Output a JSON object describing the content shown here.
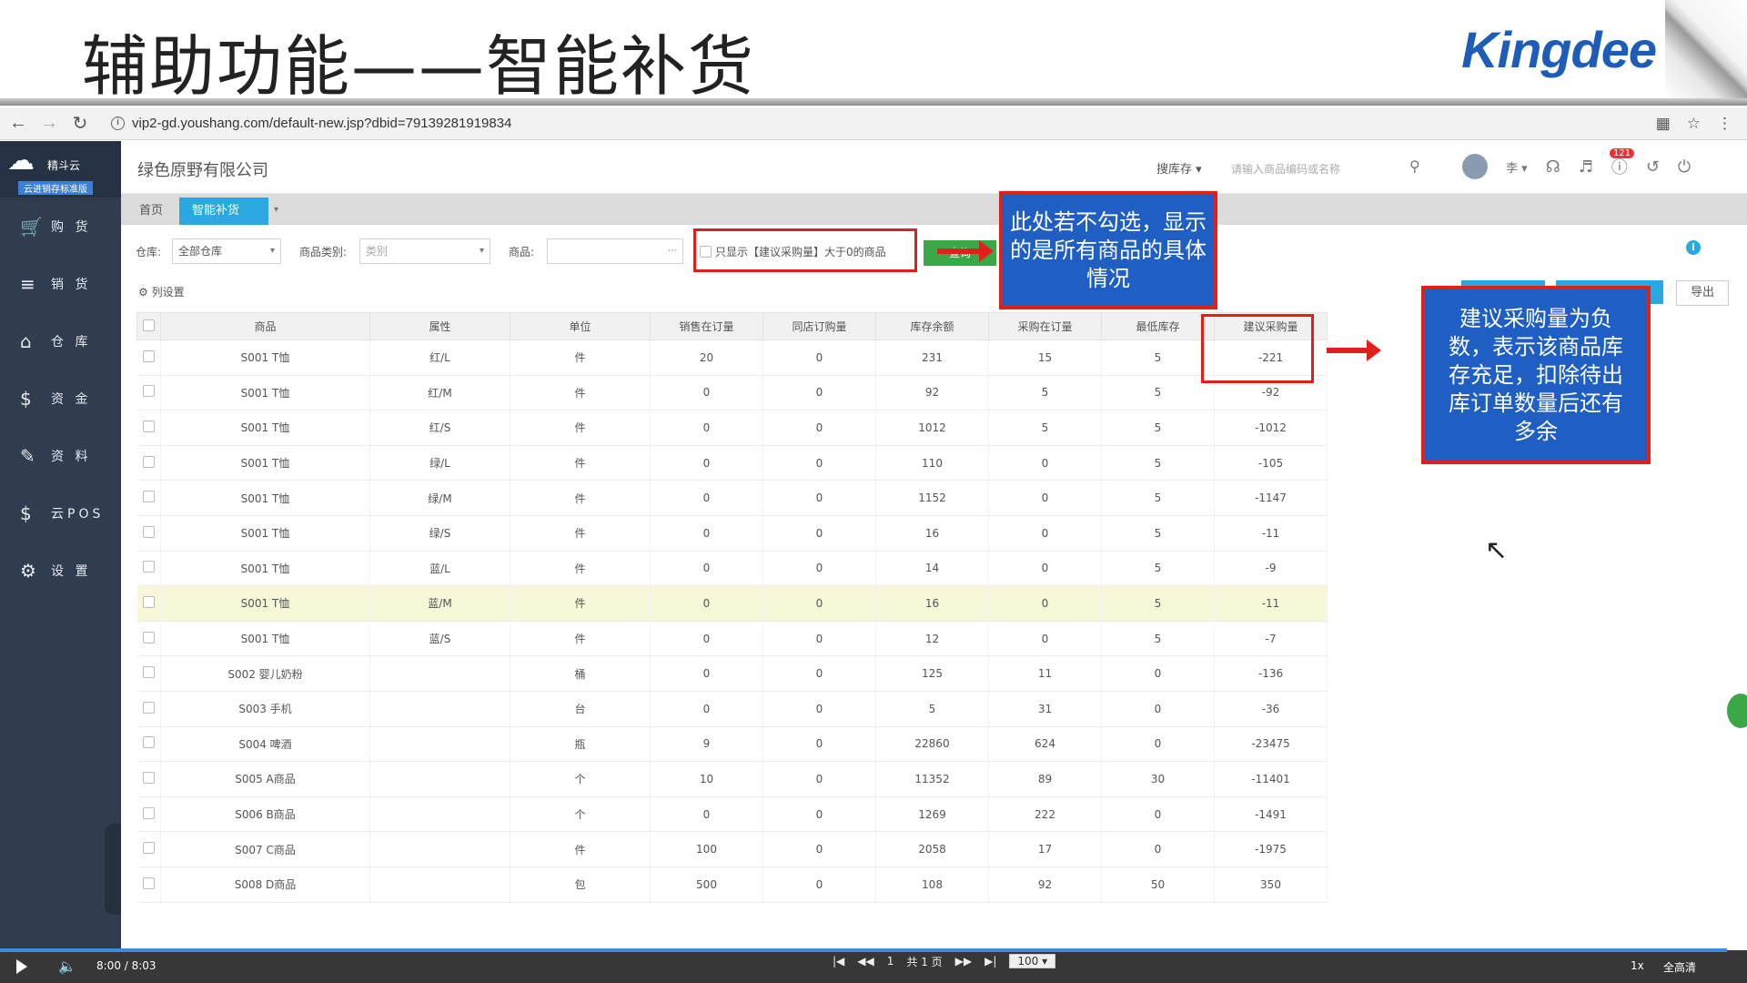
{
  "slide": {
    "title": "辅助功能——智能补货",
    "logo": "Kingdee"
  },
  "browser": {
    "url": "vip2-gd.youshang.com/default-new.jsp?dbid=79139281919834"
  },
  "sidebar": {
    "brand_name": "精斗云",
    "brand_sub": "云进销存标准版",
    "items": [
      {
        "label": "购 货",
        "icon": "cart-icon"
      },
      {
        "label": "销 货",
        "icon": "sales-icon"
      },
      {
        "label": "仓 库",
        "icon": "warehouse-icon"
      },
      {
        "label": "资 金",
        "icon": "money-icon"
      },
      {
        "label": "资 料",
        "icon": "pencil-icon"
      },
      {
        "label": "云POS",
        "icon": "pos-icon"
      },
      {
        "label": "设 置",
        "icon": "gear-icon"
      }
    ]
  },
  "header": {
    "company": "绿色原野有限公司",
    "search_type": "搜库存",
    "search_placeholder": "请输入商品编码或名称",
    "user": "李",
    "badge": "121"
  },
  "tabs": {
    "home": "首页",
    "active": "智能补货"
  },
  "filters": {
    "warehouse_label": "仓库:",
    "warehouse_value": "全部仓库",
    "category_label": "商品类别:",
    "category_placeholder": "类别",
    "product_label": "商品:",
    "only_show_label": "只显示【建议采购量】大于0的商品",
    "query_button": "查询"
  },
  "toolbar": {
    "column_settings": "列设置",
    "export": "导出"
  },
  "table": {
    "headers": [
      "商品",
      "属性",
      "单位",
      "销售在订量",
      "同店订购量",
      "库存余额",
      "采购在订量",
      "最低库存",
      "建议采购量"
    ],
    "rows": [
      [
        "S001 T恤",
        "红/L",
        "件",
        "20",
        "0",
        "231",
        "15",
        "5",
        "-221"
      ],
      [
        "S001 T恤",
        "红/M",
        "件",
        "0",
        "0",
        "92",
        "5",
        "5",
        "-92"
      ],
      [
        "S001 T恤",
        "红/S",
        "件",
        "0",
        "0",
        "1012",
        "5",
        "5",
        "-1012"
      ],
      [
        "S001 T恤",
        "绿/L",
        "件",
        "0",
        "0",
        "110",
        "0",
        "5",
        "-105"
      ],
      [
        "S001 T恤",
        "绿/M",
        "件",
        "0",
        "0",
        "1152",
        "0",
        "5",
        "-1147"
      ],
      [
        "S001 T恤",
        "绿/S",
        "件",
        "0",
        "0",
        "16",
        "0",
        "5",
        "-11"
      ],
      [
        "S001 T恤",
        "蓝/L",
        "件",
        "0",
        "0",
        "14",
        "0",
        "5",
        "-9"
      ],
      [
        "S001 T恤",
        "蓝/M",
        "件",
        "0",
        "0",
        "16",
        "0",
        "5",
        "-11"
      ],
      [
        "S001 T恤",
        "蓝/S",
        "件",
        "0",
        "0",
        "12",
        "0",
        "5",
        "-7"
      ],
      [
        "S002 婴儿奶粉",
        "",
        "桶",
        "0",
        "0",
        "125",
        "11",
        "0",
        "-136"
      ],
      [
        "S003 手机",
        "",
        "台",
        "0",
        "0",
        "5",
        "31",
        "0",
        "-36"
      ],
      [
        "S004 啤酒",
        "",
        "瓶",
        "9",
        "0",
        "22860",
        "624",
        "0",
        "-23475"
      ],
      [
        "S005 A商品",
        "",
        "个",
        "10",
        "0",
        "11352",
        "89",
        "30",
        "-11401"
      ],
      [
        "S006 B商品",
        "",
        "个",
        "0",
        "0",
        "1269",
        "222",
        "0",
        "-1491"
      ],
      [
        "S007 C商品",
        "",
        "件",
        "100",
        "0",
        "2058",
        "17",
        "0",
        "-1975"
      ],
      [
        "S008 D商品",
        "",
        "包",
        "500",
        "0",
        "108",
        "92",
        "50",
        "350"
      ]
    ]
  },
  "annotations": {
    "callout1": "此处若不勾选，显示的是所有商品的具体情况",
    "callout2": "建议采购量为负数，表示该商品库存充足，扣除待出库订单数量后还有多余"
  },
  "pager": {
    "page_input": "1",
    "total": "共 1 页",
    "page_size": "100"
  },
  "player": {
    "time": "8:00 / 8:03",
    "speed": "1x",
    "quality": "全高清"
  }
}
